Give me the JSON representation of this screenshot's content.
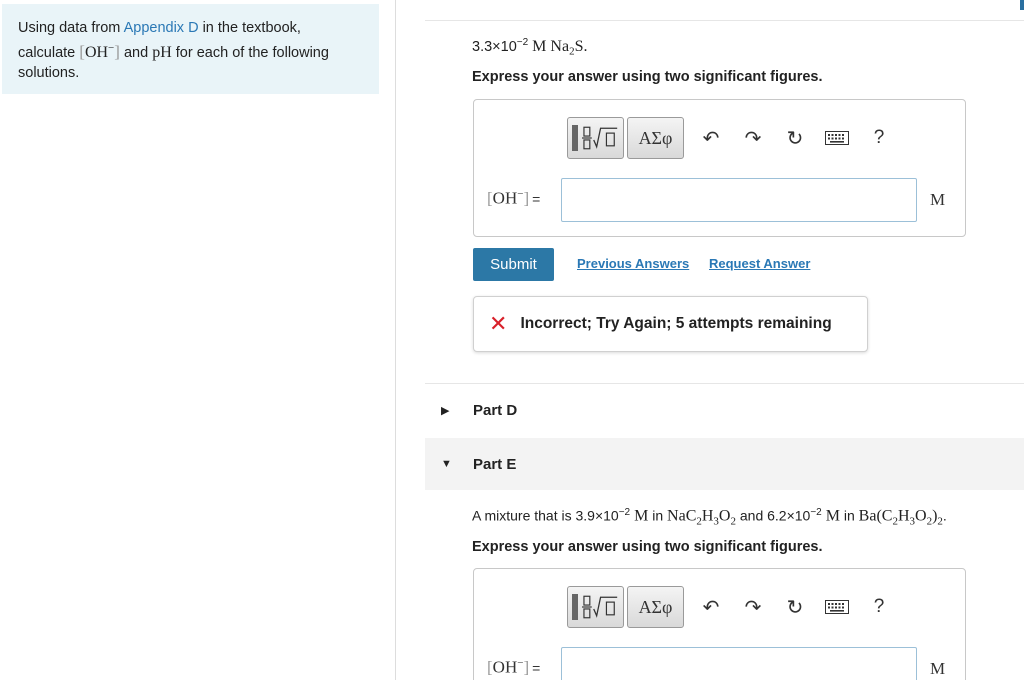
{
  "intro": {
    "text_before_link": "Using data from ",
    "link_text": "Appendix D",
    "text_after_link": " in the textbook,",
    "line2_prefix": "calculate ",
    "oh": "OH",
    "oh_sup": "−",
    "and": " and ",
    "ph": "pH",
    "line2_suffix": " for each of the following",
    "line3": "solutions."
  },
  "part_c": {
    "question_coef": "3.3×10",
    "question_exp": "−2",
    "question_unit": " M ",
    "question_species": "Na",
    "question_sub": "2",
    "question_end": "S.",
    "instruction": "Express your answer using two significant figures.",
    "toolbar": {
      "greek_label": "ΑΣφ",
      "undo": "↶",
      "redo": "↷",
      "reset": "↻",
      "help": "?"
    },
    "answer_var": "OH",
    "answer_var_sup": "−",
    "answer_eq": "=",
    "answer_value": "",
    "unit": "M",
    "submit_label": "Submit",
    "previous_answers_label": "Previous Answers",
    "request_answer_label": "Request Answer",
    "feedback": "Incorrect; Try Again; 5 attempts remaining"
  },
  "part_d": {
    "label": "Part D",
    "collapsed_icon": "▶"
  },
  "part_e": {
    "label": "Part E",
    "expanded_icon": "▼",
    "question_pre": "A mixture that is ",
    "c1_coef": "3.9×10",
    "c1_exp": "−2",
    "c1_unit": " M",
    "in1": " in ",
    "s1": "NaC",
    "s1_sub1": "2",
    "s1_h": "H",
    "s1_sub2": "3",
    "s1_o": "O",
    "s1_sub3": "2",
    "and": " and ",
    "c2_coef": "6.2×10",
    "c2_exp": "−2",
    "c2_unit": " M",
    "in2": " in ",
    "s2": "Ba(C",
    "s2_sub1": "2",
    "s2_h": "H",
    "s2_sub2": "3",
    "s2_o": "O",
    "s2_sub3": "2",
    "s2_close": ")",
    "s2_sub4": "2",
    "s2_end": ".",
    "instruction": "Express your answer using two significant figures.",
    "toolbar": {
      "greek_label": "ΑΣφ",
      "undo": "↶",
      "redo": "↷",
      "reset": "↻",
      "help": "?"
    },
    "answer_var": "OH",
    "answer_var_sup": "−",
    "answer_eq": "=",
    "answer_value": "",
    "unit": "M"
  },
  "colors": {
    "accent": "#2c78a6",
    "link": "#2a78b5",
    "error": "#d8202a",
    "panel_bg": "#e9f4f8"
  }
}
